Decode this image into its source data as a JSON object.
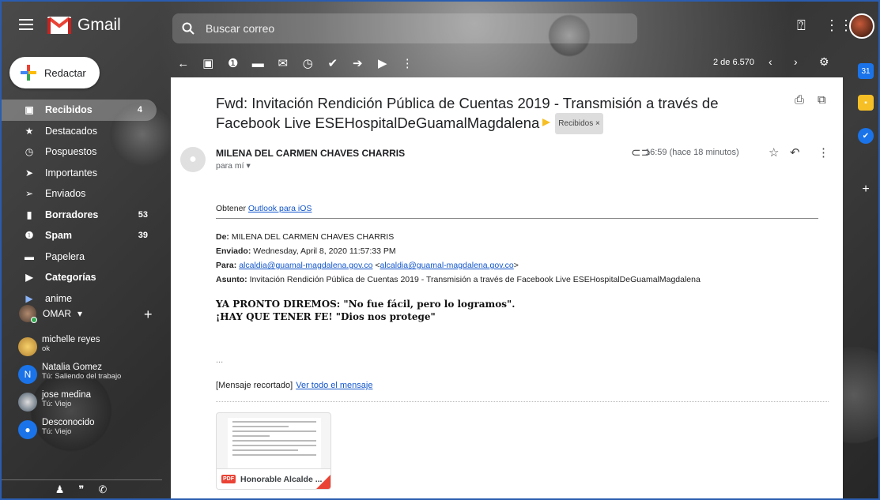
{
  "app": {
    "name": "Gmail"
  },
  "colors": {
    "accent": "#1a73e8",
    "important": "#f6bf26",
    "active_dot": "#34a853",
    "pdf": "#ea4335"
  },
  "search": {
    "placeholder": "Buscar correo"
  },
  "compose": {
    "label": "Redactar"
  },
  "nav": [
    {
      "label": "Recibidos",
      "count": "4",
      "icon": "inbox-icon",
      "active": true
    },
    {
      "label": "Destacados",
      "count": "",
      "icon": "star-icon"
    },
    {
      "label": "Pospuestos",
      "count": "",
      "icon": "clock-icon"
    },
    {
      "label": "Importantes",
      "count": "",
      "icon": "important-icon"
    },
    {
      "label": "Enviados",
      "count": "",
      "icon": "send-icon"
    },
    {
      "label": "Borradores",
      "count": "53",
      "icon": "draft-icon",
      "bold": true
    },
    {
      "label": "Spam",
      "count": "39",
      "icon": "spam-icon",
      "bold": true
    },
    {
      "label": "Papelera",
      "count": "",
      "icon": "trash-icon"
    },
    {
      "label": "Categorías",
      "count": "",
      "icon": "label-icon",
      "bold": true
    },
    {
      "label": "anime",
      "count": "",
      "icon": "label-icon"
    }
  ],
  "chat": {
    "me": "OMAR",
    "contacts": [
      {
        "name": "michelle reyes",
        "status": "ok"
      },
      {
        "name": "Natalia Gomez",
        "status": "Tú: Saliendo del trabajo",
        "initial": "N"
      },
      {
        "name": "jose medina",
        "status": "Tú: Viejo"
      },
      {
        "name": "Desconocido",
        "status": "Tú: Viejo"
      }
    ]
  },
  "toolbar": {
    "pager": "2 de 6.570"
  },
  "message": {
    "subject": "Fwd: Invitación Rendición Pública de Cuentas 2019 - Transmisión a través de Facebook Live ESEHospitalDeGuamalMagdalena",
    "label_chip": "Recibidos ×",
    "sender": "MILENA DEL CARMEN CHAVES CHARRIS",
    "to": "para mí ▾",
    "time": "16:59 (hace 18 minutos)",
    "obtener": "Obtener",
    "outlook_link": "Outlook para iOS",
    "de_label": "De:",
    "de_value": "MILENA DEL CARMEN CHAVES CHARRIS",
    "enviado_label": "Enviado:",
    "enviado_value": "Wednesday, April 8, 2020 11:57:33 PM",
    "para_label": "Para:",
    "para_email": "alcaldia@guamal-magdalena.gov.co",
    "para_email2": "alcaldia@guamal-magdalena.gov.co",
    "asunto_label": "Asunto:",
    "asunto_value": "Invitación Rendición Pública de Cuentas 2019 - Transmisión a través de Facebook Live ESEHospitalDeGuamalMagdalena",
    "line1": "YA PRONTO DIREMOS: \"No fue fácil, pero lo logramos\".",
    "line2": "¡HAY QUE TENER FE! \"Dios nos protege\"",
    "ellipsis": "...",
    "clipped": "[Mensaje recortado]",
    "view_all": "Ver todo el mensaje",
    "attachment": "Honorable Alcalde ...",
    "pdf_badge": "PDF"
  }
}
